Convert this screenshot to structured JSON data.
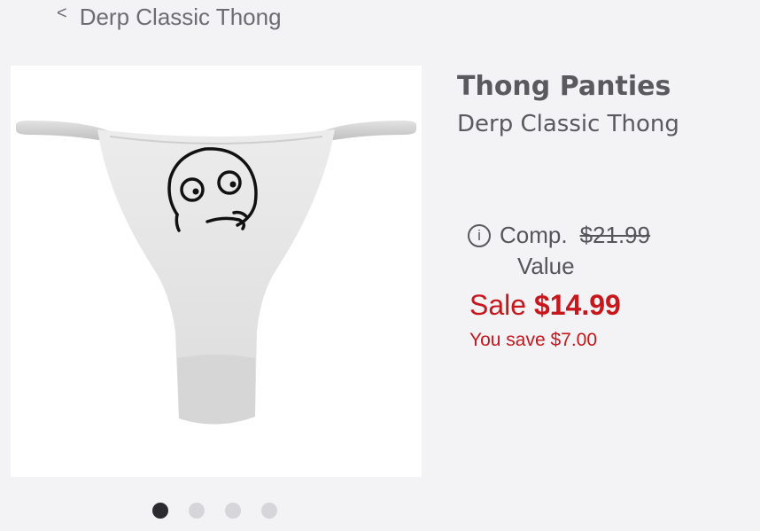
{
  "nav": {
    "back_chevron": "<",
    "back_label": "Derp Classic Thong"
  },
  "product": {
    "title": "Thong Panties",
    "subtitle": "Derp Classic Thong",
    "image_name": "derp-face-thong-image"
  },
  "pricing": {
    "info_icon": "i",
    "comp_label": "Comp.",
    "comp_price": "$21.99",
    "comp_value_label": "Value",
    "sale_label": "Sale",
    "sale_price": "$14.99",
    "you_save": "You save $7.00",
    "sale_color": "#c8161d"
  },
  "carousel": {
    "total": 4,
    "active_index": 0
  }
}
